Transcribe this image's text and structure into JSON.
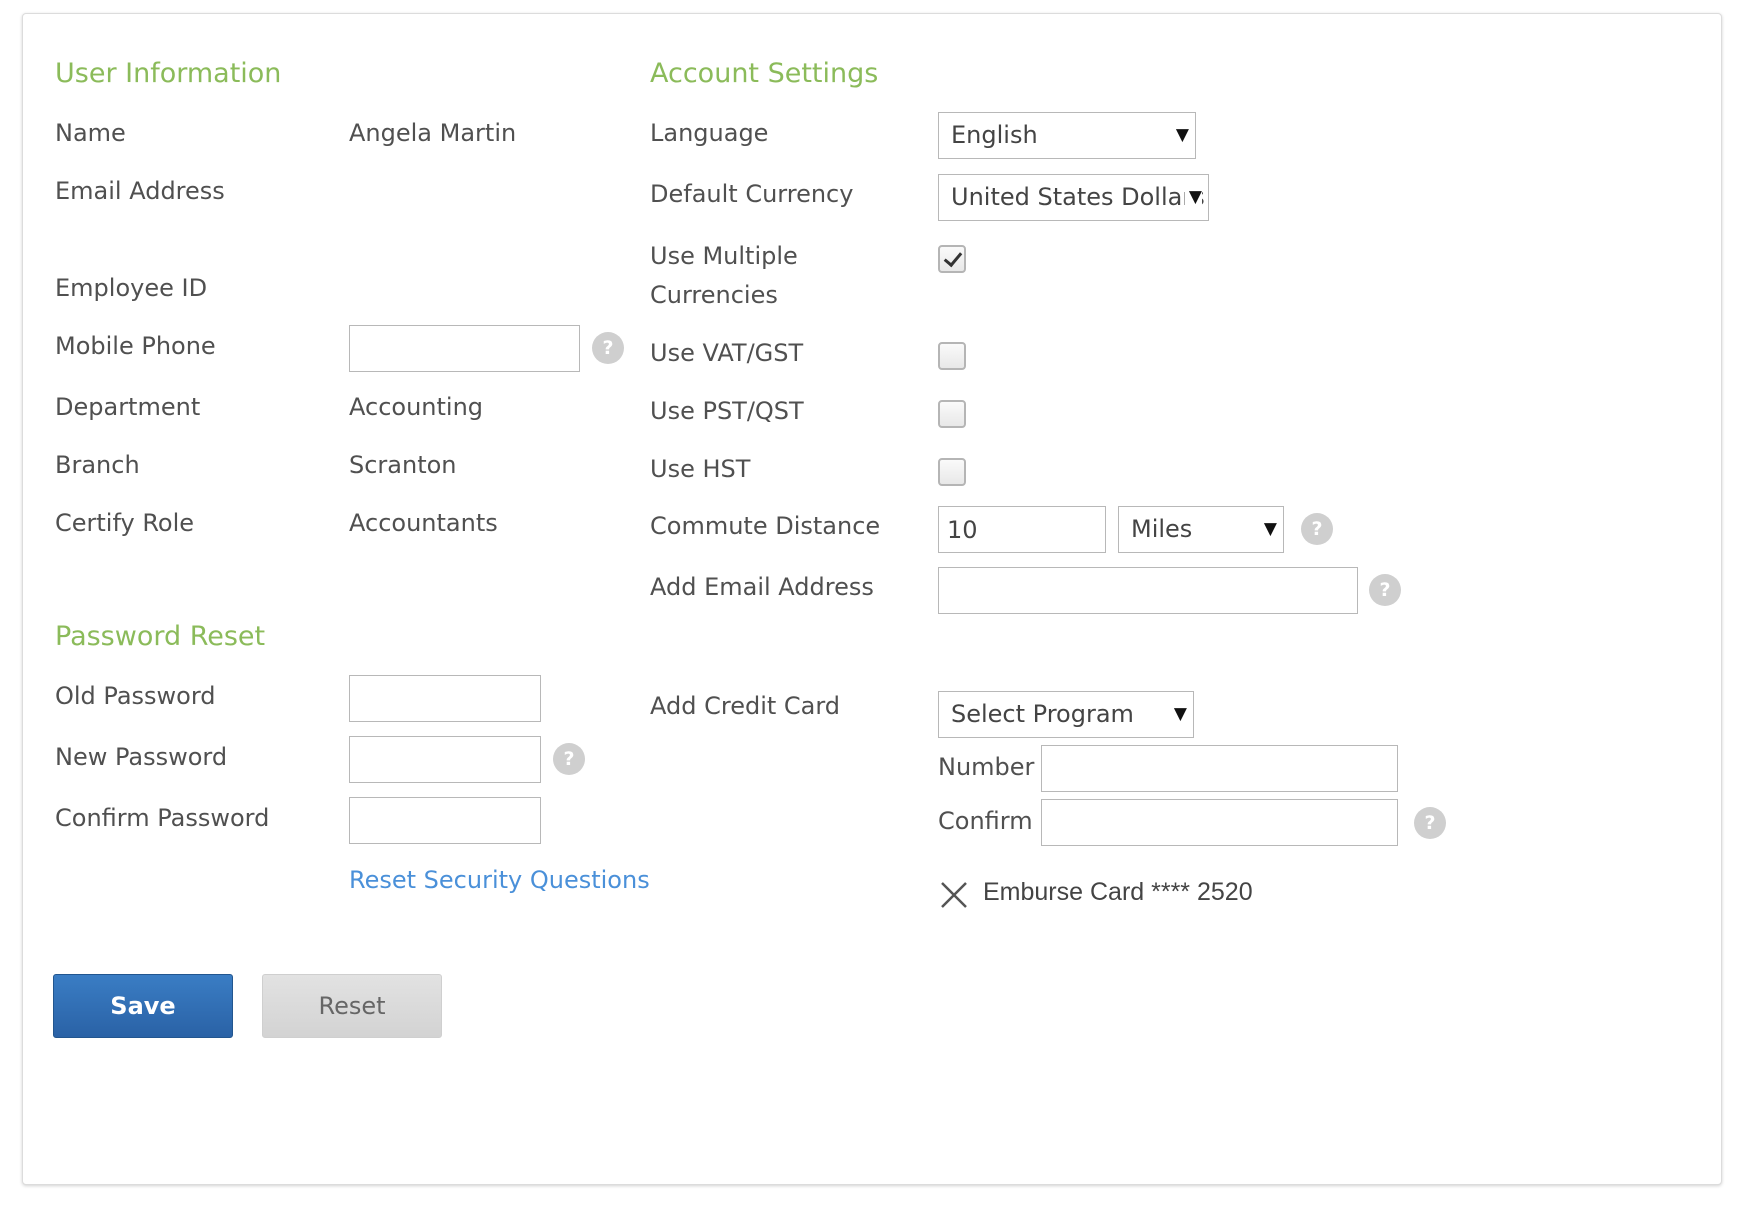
{
  "user_info": {
    "heading": "User Information",
    "name_label": "Name",
    "name_value": "Angela Martin",
    "email_label": "Email Address",
    "employee_id_label": "Employee ID",
    "mobile_label": "Mobile Phone",
    "mobile_value": "",
    "department_label": "Department",
    "department_value": "Accounting",
    "branch_label": "Branch",
    "branch_value": "Scranton",
    "certify_label": "Certify Role",
    "certify_value": "Accountants"
  },
  "password_reset": {
    "heading": "Password Reset",
    "old_label": "Old Password",
    "new_label": "New Password",
    "confirm_label": "Confirm Password",
    "reset_questions_link": "Reset Security Questions"
  },
  "account_settings": {
    "heading": "Account Settings",
    "language_label": "Language",
    "language_value": "English",
    "currency_label": "Default Currency",
    "currency_value": "United States Dollars",
    "multi_currency_label_1": "Use Multiple",
    "multi_currency_label_2": "Currencies",
    "multi_currency_checked": true,
    "vat_label": "Use VAT/GST",
    "vat_checked": false,
    "pst_label": "Use PST/QST",
    "pst_checked": false,
    "hst_label": "Use HST",
    "hst_checked": false,
    "commute_label": "Commute Distance",
    "commute_value": "10",
    "commute_unit": "Miles",
    "add_email_label": "Add Email Address",
    "add_email_value": "",
    "add_card_label": "Add Credit Card",
    "program_value": "Select Program",
    "number_label": "Number",
    "confirm_label": "Confirm",
    "card_text": "Emburse Card **** 2520"
  },
  "help_glyph": "?",
  "caret_glyph": "▼",
  "buttons": {
    "save": "Save",
    "reset": "Reset"
  }
}
